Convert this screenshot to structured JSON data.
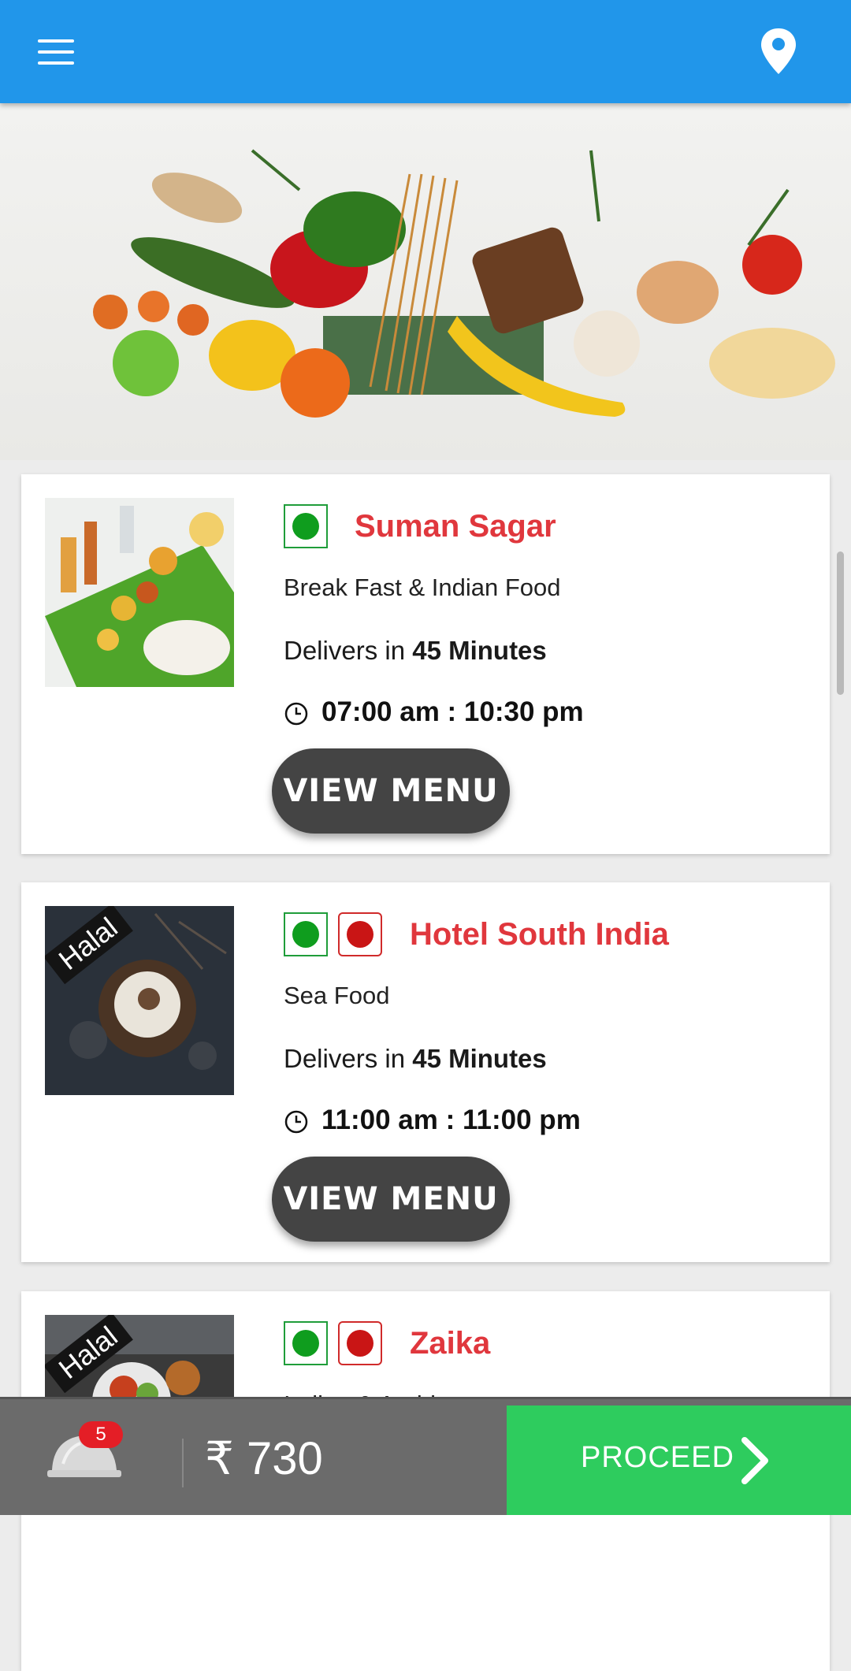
{
  "app_bar": {
    "menu_icon": "hamburger-menu-icon",
    "location_icon": "location-pin-icon",
    "color": "#2196ea"
  },
  "banner": {
    "alt": "assorted fresh vegetables, fruits and grains"
  },
  "restaurants": [
    {
      "name": "Suman Sagar",
      "cuisine": "Break Fast & Indian Food",
      "delivers_prefix": "Delivers in",
      "delivery_time": "45 Minutes",
      "hours": "07:00 am : 10:30 pm",
      "button_label": "VIEW MENU",
      "veg": true,
      "non_veg": false
    },
    {
      "name": "Hotel South India",
      "cuisine": "Sea Food",
      "delivers_prefix": "Delivers in",
      "delivery_time": "45 Minutes",
      "hours": "11:00 am : 11:00 pm",
      "button_label": "VIEW MENU",
      "halal_label": "Halal",
      "veg": true,
      "non_veg": true
    },
    {
      "name": "Zaika",
      "cuisine": "Indian & Arabian",
      "halal_label": "Halal",
      "veg": true,
      "non_veg": true
    }
  ],
  "cart": {
    "item_count": "5",
    "currency_symbol": "₹",
    "total": "730",
    "proceed_label": "PROCEED",
    "proceed_color": "#2ecc5e"
  },
  "colors": {
    "restaurant_name": "#e0373d",
    "veg": "#0f9d1e",
    "non_veg": "#c91515"
  }
}
